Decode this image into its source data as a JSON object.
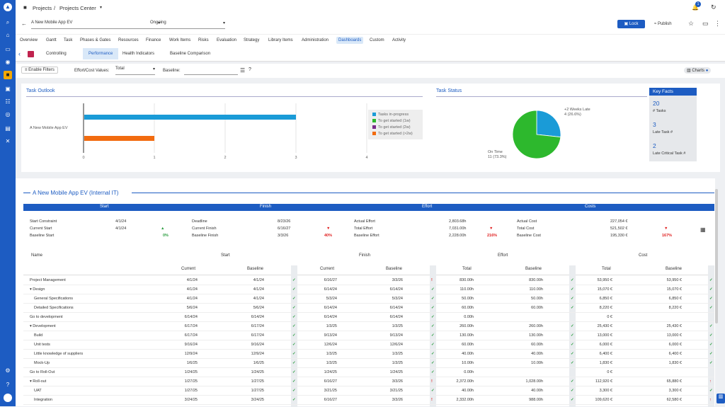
{
  "breadcrumb": {
    "projects": "Projects",
    "sep": "/",
    "center": "Projects Center"
  },
  "project_select": "A New Mobile App EV",
  "status_select": "Ongoing",
  "actions": {
    "lock": "Lock",
    "publish": "Publish",
    "notif_count": "1"
  },
  "tabs": [
    "Overview",
    "Gantt",
    "Task",
    "Phases & Gates",
    "Resources",
    "Finance",
    "Work Items",
    "Risks",
    "Evaluation",
    "Strategy",
    "Library Items",
    "Administration",
    "Dashboards",
    "Custom",
    "Activity"
  ],
  "subtabs": [
    "Controlling",
    "Performance",
    "Health Indicators",
    "Baseline Comparison"
  ],
  "filters": {
    "enable": "Enable Filters",
    "effort_label": "Effort/Cost Values:",
    "effort_value": "Total",
    "baseline_label": "Baseline:",
    "charts": "Charts"
  },
  "outlook": {
    "title": "Task Outlook",
    "row_label": "A New Mobile App EV",
    "ticks": [
      "0",
      "1",
      "2",
      "3",
      "4"
    ]
  },
  "legend": [
    "Tasks in-progress",
    "To get started (1w)",
    "To get started (2w)",
    "To get started (>2w)"
  ],
  "status": {
    "title": "Task Status",
    "late": "+2 Weeks Late",
    "late_val": "4 (26.6%)",
    "ontime": "On Time",
    "ontime_val": "11 (73.3%)"
  },
  "chart_data": [
    {
      "type": "bar",
      "categories": [
        "A New Mobile App EV"
      ],
      "series": [
        {
          "name": "Tasks in-progress",
          "values": [
            3
          ]
        },
        {
          "name": "To get started (>2w)",
          "values": [
            1
          ]
        }
      ],
      "xlim": [
        0,
        4
      ]
    },
    {
      "type": "pie",
      "labels": [
        "On Time",
        "+2 Weeks Late"
      ],
      "values": [
        11,
        4
      ]
    }
  ],
  "keyfacts": {
    "title": "Key Facts",
    "items": [
      {
        "v": "20",
        "l": "# Tasks"
      },
      {
        "v": "3",
        "l": "Late Task #"
      },
      {
        "v": "2",
        "l": "Late Critical Task #"
      }
    ]
  },
  "detail_title": "A New Mobile App EV (Internal IT)",
  "groups": [
    "Start",
    "Finish",
    "Effort",
    "Costs"
  ],
  "summary": [
    [
      "Start Constraint",
      "4/1/24",
      "",
      "Deadline",
      "8/23/26",
      "",
      "Actual Effort",
      "2,803.68h",
      "",
      "Actual Cost",
      "227,054 €",
      ""
    ],
    [
      "Current Start",
      "4/1/24",
      "",
      "Current Finish",
      "6/16/27",
      "",
      "Total Effort",
      "7,031.00h",
      "",
      "Total Cost",
      "521,502 €",
      ""
    ],
    [
      "Baseline Start",
      "",
      "0%",
      "Baseline Finish",
      "3/3/26",
      "40%",
      "Baseline Effort",
      "2,228.00h",
      "216%",
      "Baseline Cost",
      "195,330 €",
      "167%"
    ]
  ],
  "cols": {
    "name": "Name",
    "start": "Start",
    "finish": "Finish",
    "effort": "Effort",
    "cost": "Cost",
    "current": "Current",
    "baseline": "Baseline",
    "total": "Total"
  },
  "rows": [
    [
      "Project Management",
      "4/1/24",
      "4/1/24",
      "6/16/27",
      "3/3/26",
      "830.00h",
      "830.00h",
      "53,950 €",
      "53,950 €"
    ],
    [
      "▾ Design",
      "4/1/24",
      "4/1/24",
      "6/14/24",
      "6/14/24",
      "110.00h",
      "110.00h",
      "15,070 €",
      "15,070 €"
    ],
    [
      "General Specifications",
      "4/1/24",
      "4/1/24",
      "5/3/24",
      "5/3/24",
      "50.00h",
      "50.00h",
      "6,850 €",
      "6,850 €"
    ],
    [
      "Detailed Specifications",
      "5/6/24",
      "5/6/24",
      "6/14/24",
      "6/14/24",
      "60.00h",
      "60.00h",
      "8,220 €",
      "8,220 €"
    ],
    [
      "Go to development",
      "6/14/24",
      "6/14/24",
      "6/14/24",
      "6/14/24",
      "0.00h",
      "",
      "0 €",
      ""
    ],
    [
      "▾ Development",
      "6/17/24",
      "6/17/24",
      "1/3/25",
      "1/3/25",
      "260.00h",
      "260.00h",
      "25,430 €",
      "25,430 €"
    ],
    [
      "Build",
      "6/17/24",
      "6/17/24",
      "9/13/24",
      "9/13/24",
      "130.00h",
      "130.00h",
      "13,000 €",
      "13,000 €"
    ],
    [
      "Unit tests",
      "9/16/24",
      "9/16/24",
      "12/6/24",
      "12/6/24",
      "60.00h",
      "60.00h",
      "6,000 €",
      "6,000 €"
    ],
    [
      "Little knowledge of suppliers",
      "12/9/24",
      "12/9/24",
      "1/3/25",
      "1/3/25",
      "40.00h",
      "40.00h",
      "6,400 €",
      "6,400 €"
    ],
    [
      "Mock-Up",
      "1/6/25",
      "1/6/25",
      "1/3/25",
      "1/3/25",
      "10.00h",
      "10.00h",
      "1,830 €",
      "1,830 €"
    ],
    [
      "Go to Roll-Out",
      "1/24/25",
      "1/24/25",
      "1/24/25",
      "1/24/25",
      "0.00h",
      "",
      "0 €",
      ""
    ],
    [
      "▾ Roll-out",
      "1/27/25",
      "1/27/25",
      "6/16/27",
      "3/3/26",
      "2,372.00h",
      "1,028.00h",
      "112,920 €",
      "65,880 €"
    ],
    [
      "UAT",
      "1/27/25",
      "1/27/25",
      "3/21/25",
      "3/21/25",
      "40.00h",
      "40.00h",
      "3,300 €",
      "3,300 €"
    ],
    [
      "Integration",
      "3/24/25",
      "3/24/25",
      "6/16/27",
      "3/3/26",
      "2,332.00h",
      "988.00h",
      "109,620 €",
      "62,580 €"
    ]
  ]
}
